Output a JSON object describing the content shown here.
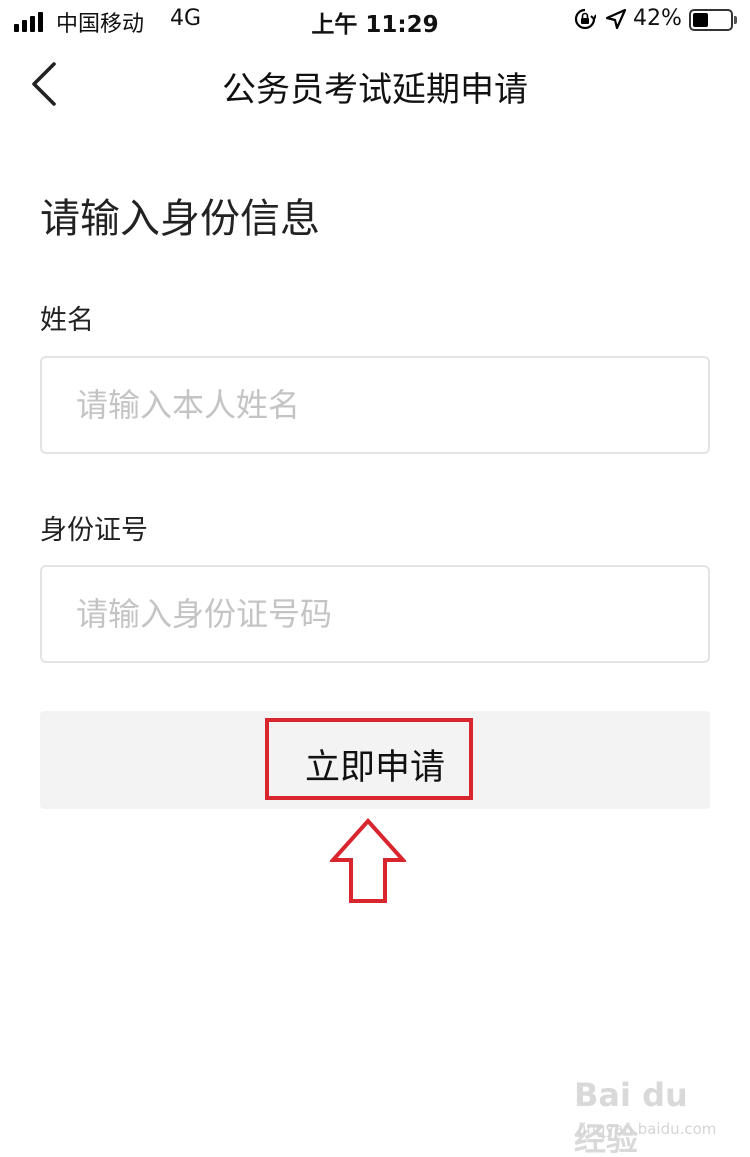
{
  "status_bar": {
    "carrier": "中国移动",
    "network": "4G",
    "time": "上午 11:29",
    "battery_percent": "42%",
    "battery_level": 0.42,
    "icons": [
      "signal-icon",
      "orientation-lock-icon",
      "location-icon",
      "battery-icon"
    ]
  },
  "nav": {
    "back_icon": "chevron-left-icon",
    "title": "公务员考试延期申请"
  },
  "form": {
    "heading": "请输入身份信息",
    "name_label": "姓名",
    "name_placeholder": "请输入本人姓名",
    "name_value": "",
    "id_label": "身份证号",
    "id_placeholder": "请输入身份证号码",
    "id_value": "",
    "submit_label": "立即申请"
  },
  "annotation": {
    "highlight_color": "#d8252e",
    "pointer_icon": "up-arrow-icon"
  },
  "watermark": {
    "brand": "Bai du 经验",
    "url": "jingyan.baidu.com"
  }
}
